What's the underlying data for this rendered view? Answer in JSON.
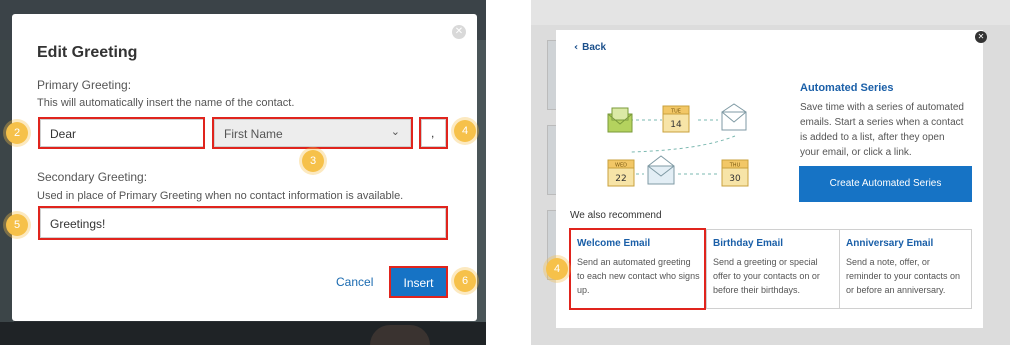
{
  "left": {
    "title": "Edit Greeting",
    "primary_label": "Primary Greeting:",
    "primary_help": "This will automatically insert the name of the contact.",
    "greeting_value": "Dear",
    "name_select_value": "First Name",
    "punctuation_value": ",",
    "secondary_label": "Secondary Greeting:",
    "secondary_help": "Used in place of Primary Greeting when no contact information is available.",
    "secondary_value": "Greetings!",
    "cancel_label": "Cancel",
    "insert_label": "Insert",
    "step_badges": [
      "2",
      "3",
      "4",
      "5",
      "6"
    ]
  },
  "right": {
    "back_label": "Back",
    "series_title": "Automated Series",
    "series_description": "Save time with a series of automated emails. Start a series when a contact is added to a list, after they open your email, or click a link.",
    "create_button": "Create Automated Series",
    "recommend_label": "We also recommend",
    "calendar_days": [
      {
        "month": "TUE",
        "day": "14"
      },
      {
        "month": "WED",
        "day": "22"
      },
      {
        "month": "THU",
        "day": "30"
      }
    ],
    "tiles": [
      {
        "title": "Welcome Email",
        "description": "Send an automated greeting to each new contact who signs up."
      },
      {
        "title": "Birthday Email",
        "description": "Send a greeting or special offer to your contacts on or before their birthdays."
      },
      {
        "title": "Anniversary Email",
        "description": "Send a note, offer, or reminder to your contacts on or before an anniversary."
      }
    ],
    "step_badge": "4"
  },
  "colors": {
    "highlight": "#e0241d",
    "primary_button": "#1673c5",
    "badge": "#f6c14a",
    "link": "#1a5fa8"
  }
}
